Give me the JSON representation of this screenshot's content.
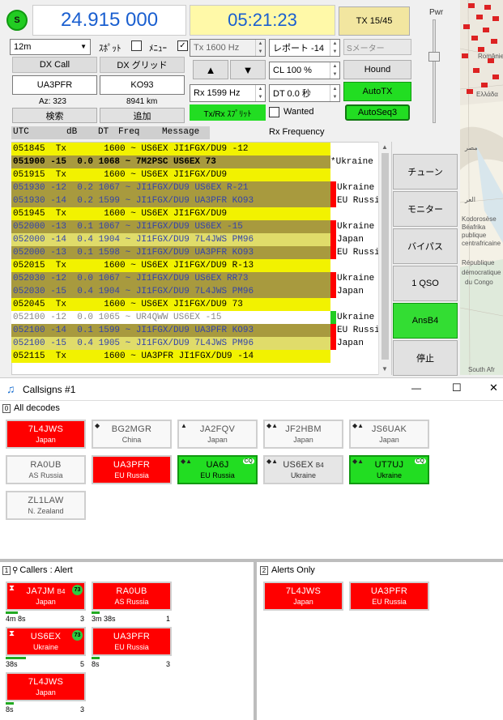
{
  "top": {
    "s_badge": "S",
    "frequency": "24.915 000",
    "time": "05:21:23",
    "tx_button": "TX 15/45",
    "pwr_label": "Pwr",
    "band": "12m",
    "spot_label": "ｽﾎﾟｯﾄ",
    "menu_label": "ﾒﾆｭｰ",
    "dx_call_label": "DX Call",
    "dx_grid_label": "DX グリッド",
    "dx_call": "UA3PFR",
    "dx_grid": "KO93",
    "az": "Az: 323",
    "dist": "8941 km",
    "search_btn": "検索",
    "add_btn": "追加",
    "tx_freq": "Tx  1600  Hz",
    "report": "レポート -14",
    "s_meter": "Sメーター",
    "cl": "CL  100 %",
    "hound": "Hound",
    "rx_freq": "Rx  1599  Hz",
    "dt": "DT 0.0 秒",
    "autotx": "AutoTX",
    "txrx_split": "Tx/Rx ｽﾌﾟﾘｯﾄ",
    "wanted": "Wanted",
    "autoseq": "AutoSeq3",
    "up_arrow": "▲",
    "down_arrow": "▼"
  },
  "decode_header": {
    "utc": "UTC",
    "db": "dB",
    "dt": "DT",
    "freq": "Freq",
    "message": "Message",
    "rx_frequency": "Rx  Frequency"
  },
  "decodes": [
    {
      "text": "051845  Tx       1600 ~ US6EX JI1FGX/DU9 -12",
      "bg": "#f2f200",
      "fg": "#000",
      "side": "",
      "mark": ""
    },
    {
      "text": "051900 -15  0.0 1068 ~ 7M2PSC US6EX 73",
      "bg": "#a89a3e",
      "fg": "#000",
      "side": "*Ukraine",
      "mark": "",
      "bold": true
    },
    {
      "text": "051915  Tx       1600 ~ US6EX JI1FGX/DU9",
      "bg": "#f2f200",
      "fg": "#000",
      "side": "",
      "mark": ""
    },
    {
      "text": "051930 -12  0.2 1067 ~ JI1FGX/DU9 US6EX R-21",
      "bg": "#a89a3e",
      "fg": "#3344aa",
      "side": "Ukraine",
      "mark": "#ff0000"
    },
    {
      "text": "051930 -14  0.2 1599 ~ JI1FGX/DU9 UA3PFR KO93",
      "bg": "#a89a3e",
      "fg": "#3344aa",
      "side": "EU Russia",
      "mark": "#ff0000"
    },
    {
      "text": "051945  Tx       1600 ~ US6EX JI1FGX/DU9",
      "bg": "#f2f200",
      "fg": "#000",
      "side": "",
      "mark": ""
    },
    {
      "text": "052000 -13  0.1 1067 ~ JI1FGX/DU9 US6EX -15",
      "bg": "#a89a3e",
      "fg": "#3344aa",
      "side": "Ukraine",
      "mark": "#ff0000"
    },
    {
      "text": "052000 -14  0.4 1904 ~ JI1FGX/DU9 7L4JWS PM96",
      "bg": "#e0dc6a",
      "fg": "#3344aa",
      "side": "Japan",
      "mark": "#ff0000"
    },
    {
      "text": "052000 -13  0.1 1598 ~ JI1FGX/DU9 UA3PFR KO93",
      "bg": "#a89a3e",
      "fg": "#3344aa",
      "side": "EU Russia",
      "mark": "#ff0000"
    },
    {
      "text": "052015  Tx       1600 ~ US6EX JI1FGX/DU9 R-13",
      "bg": "#f2f200",
      "fg": "#000",
      "side": "",
      "mark": ""
    },
    {
      "text": "052030 -12  0.0 1067 ~ JI1FGX/DU9 US6EX RR73",
      "bg": "#a89a3e",
      "fg": "#3344aa",
      "side": "Ukraine",
      "mark": "#ff0000"
    },
    {
      "text": "052030 -15  0.4 1904 ~ JI1FGX/DU9 7L4JWS PM96",
      "bg": "#a89a3e",
      "fg": "#3344aa",
      "side": "Japan",
      "mark": "#ff0000"
    },
    {
      "text": "052045  Tx       1600 ~ US6EX JI1FGX/DU9 73",
      "bg": "#f2f200",
      "fg": "#000",
      "side": "",
      "mark": ""
    },
    {
      "text": "052100 -12  0.0 1065 ~ UR4QWW US6EX -15",
      "bg": "#ffffff",
      "fg": "#888",
      "side": "Ukraine",
      "mark": "#22cc22"
    },
    {
      "text": "052100 -14  0.1 1599 ~ JI1FGX/DU9 UA3PFR KO93",
      "bg": "#a89a3e",
      "fg": "#3344aa",
      "side": "EU Russia",
      "mark": "#ff0000"
    },
    {
      "text": "052100 -15  0.4 1905 ~ JI1FGX/DU9 7L4JWS PM96",
      "bg": "#e0dc6a",
      "fg": "#3344aa",
      "side": "Japan",
      "mark": "#ff0000"
    },
    {
      "text": "052115  Tx       1600 ~ UA3PFR JI1FGX/DU9 -14",
      "bg": "#f2f200",
      "fg": "#000",
      "side": "",
      "mark": ""
    }
  ],
  "right_buttons": [
    "チューン",
    "モニター",
    "バイパス",
    "1 QSO",
    "AnsB4",
    "停止"
  ],
  "map_labels": [
    "Românie",
    "Ελλάδα",
    "Kodorosèse",
    "Béafrika",
    "publique",
    "centrafricaine",
    "République",
    "démocratique",
    "du Congo",
    "South Afr",
    "ﻣﺼﺮ",
    "ﺍﻟﻌﺮ"
  ],
  "callsigns_window": {
    "title": "Callsigns #1",
    "minimize": "—",
    "maximize": "☐",
    "close": "✕",
    "section0_num": "0",
    "section0_label": "All decodes",
    "section1_num": "1",
    "section1_label": "Callers : Alert",
    "section2_num": "2",
    "section2_label": "Alerts Only"
  },
  "all_decodes": [
    {
      "call": "7L4JWS",
      "country": "Japan",
      "style": "red",
      "mark": ""
    },
    {
      "call": "BG2MGR",
      "country": "China",
      "style": "white",
      "mark": "◆"
    },
    {
      "call": "JA2FQV",
      "country": "Japan",
      "style": "white",
      "mark": "▲"
    },
    {
      "call": "JF2HBM",
      "country": "Japan",
      "style": "white",
      "mark": "◆▲"
    },
    {
      "call": "JS6UAK",
      "country": "Japan",
      "style": "white",
      "mark": "◆▲"
    },
    {
      "call": "RA0UB",
      "country": "AS Russia",
      "style": "white",
      "mark": ""
    },
    {
      "call": "UA3PFR",
      "country": "EU Russia",
      "style": "red",
      "mark": ""
    },
    {
      "call": "UA6J",
      "country": "EU Russia",
      "style": "green",
      "mark": "◆▲",
      "cq": "CQ"
    },
    {
      "call": "US6EX",
      "sub": "B4",
      "country": "Ukraine",
      "style": "grey",
      "mark": "◆▲"
    },
    {
      "call": "UT7UJ",
      "country": "Ukraine",
      "style": "green",
      "mark": "◆▲",
      "cq": "CQ"
    },
    {
      "call": "ZL1LAW",
      "country": "N. Zealand",
      "style": "white",
      "mark": ""
    }
  ],
  "callers": [
    {
      "call": "JA7JM",
      "sub": "B4",
      "country": "Japan",
      "style": "red",
      "badge": "73",
      "hourglass": true,
      "time": "4m 8s",
      "count": "3",
      "bar": 0.15
    },
    {
      "call": "RA0UB",
      "country": "AS Russia",
      "style": "red",
      "time": "3m 38s",
      "count": "1",
      "bar": 0.1
    },
    {
      "call": "US6EX",
      "country": "Ukraine",
      "style": "red",
      "badge": "73",
      "hourglass": true,
      "time": "38s",
      "count": "5",
      "bar": 0.25
    },
    {
      "call": "UA3PFR",
      "country": "EU Russia",
      "style": "red",
      "time": "8s",
      "count": "3",
      "bar": 0.1
    },
    {
      "call": "7L4JWS",
      "country": "Japan",
      "style": "red",
      "time": "8s",
      "count": "3",
      "bar": 0.1
    }
  ],
  "alerts_only": [
    {
      "call": "7L4JWS",
      "country": "Japan",
      "style": "red"
    },
    {
      "call": "UA3PFR",
      "country": "EU Russia",
      "style": "red"
    }
  ],
  "colors": {
    "tx_row": "#f2f200",
    "decode_row": "#a89a3e",
    "alert_red": "#ff0000",
    "cq_green": "#22dd22",
    "time_bg": "#fff9a8",
    "freq_text": "#1a5fd0"
  }
}
